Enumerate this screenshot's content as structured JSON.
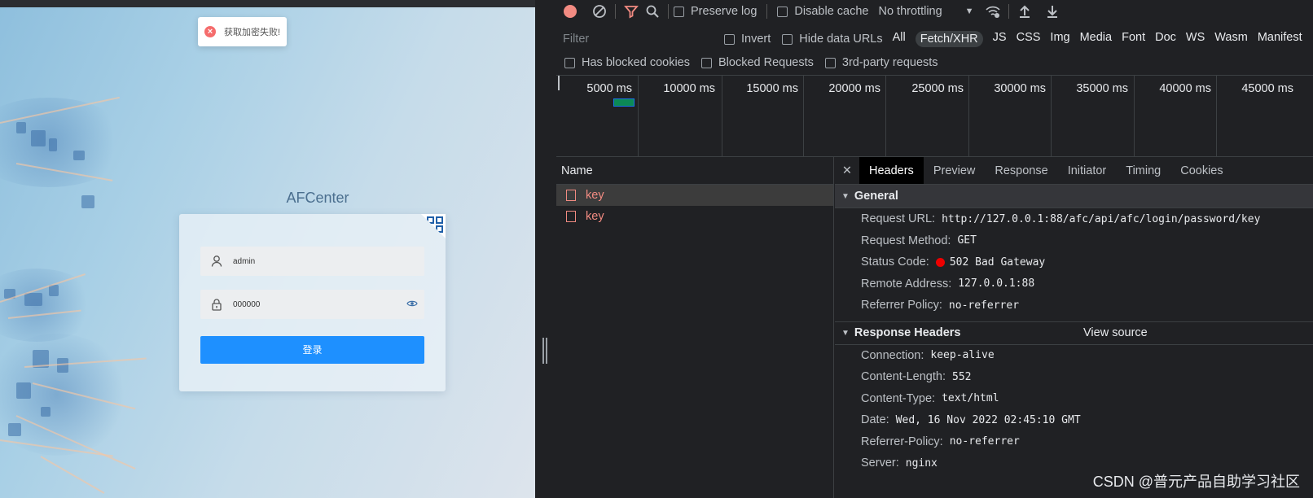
{
  "app": {
    "toast": {
      "icon": "error-circle-icon",
      "text": "获取加密失败!"
    },
    "brand": "AFCenter",
    "username": {
      "icon": "user-icon",
      "value": "admin"
    },
    "password": {
      "icon": "lock-icon",
      "value": "000000",
      "toggle_icon": "eye-icon"
    },
    "login_label": "登录",
    "qr_icon": "qr-code-icon",
    "colors": {
      "primary": "#1e90ff",
      "error": "#f56c6c"
    }
  },
  "devtools": {
    "toolbar": {
      "preserve_log": "Preserve log",
      "disable_cache": "Disable cache",
      "throttling": "No throttling",
      "icons": [
        "record-icon",
        "clear-icon",
        "filter-icon",
        "search-icon",
        "network-conditions-icon",
        "import-icon",
        "export-icon"
      ]
    },
    "filter": {
      "placeholder": "Filter",
      "invert": "Invert",
      "hide_data_urls": "Hide data URLs",
      "types": [
        "All",
        "Fetch/XHR",
        "JS",
        "CSS",
        "Img",
        "Media",
        "Font",
        "Doc",
        "WS",
        "Wasm",
        "Manifest"
      ],
      "active_type": "Fetch/XHR",
      "blocked_cookies": "Has blocked cookies",
      "blocked_requests": "Blocked Requests",
      "third_party": "3rd-party requests"
    },
    "timeline": {
      "ticks": [
        "5000 ms",
        "10000 ms",
        "15000 ms",
        "20000 ms",
        "25000 ms",
        "30000 ms",
        "35000 ms",
        "40000 ms",
        "45000 ms"
      ]
    },
    "requests": {
      "header": "Name",
      "rows": [
        "key",
        "key"
      ]
    },
    "detail": {
      "tabs": [
        "Headers",
        "Preview",
        "Response",
        "Initiator",
        "Timing",
        "Cookies"
      ],
      "active_tab": "Headers",
      "general_title": "General",
      "general": [
        {
          "k": "Request URL:",
          "v": "http://127.0.0.1:88/afc/api/afc/login/password/key"
        },
        {
          "k": "Request Method:",
          "v": "GET"
        },
        {
          "k": "Status Code:",
          "v": "502 Bad Gateway"
        },
        {
          "k": "Remote Address:",
          "v": "127.0.0.1:88"
        },
        {
          "k": "Referrer Policy:",
          "v": "no-referrer"
        }
      ],
      "response_title": "Response Headers",
      "view_source": "View source",
      "response": [
        {
          "k": "Connection:",
          "v": "keep-alive"
        },
        {
          "k": "Content-Length:",
          "v": "552"
        },
        {
          "k": "Content-Type:",
          "v": "text/html"
        },
        {
          "k": "Date:",
          "v": "Wed, 16 Nov 2022 02:45:10 GMT"
        },
        {
          "k": "Referrer-Policy:",
          "v": "no-referrer"
        },
        {
          "k": "Server:",
          "v": "nginx"
        }
      ]
    },
    "watermark": "CSDN @普元产品自助学习社区"
  }
}
